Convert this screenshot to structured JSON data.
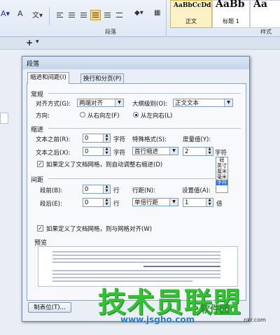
{
  "ribbon": {
    "group_paragraph": "段落",
    "group_styles": "样式",
    "styles": [
      {
        "preview": "AaBbCcDd",
        "name": "正文"
      },
      {
        "preview": "AaBb",
        "name": "标题 1"
      },
      {
        "preview": "Aa",
        "name": "标题 2"
      }
    ]
  },
  "doc": {
    "tab_add": "+",
    "tab_dropdown": "▾"
  },
  "dialog": {
    "title": "段落",
    "tabs": [
      "缩进和间距(I)",
      "换行和分页(P)"
    ],
    "general": {
      "section": "常规",
      "align_label": "对齐方式(G):",
      "align_value": "两端对齐",
      "outline_label": "大纲级别(O):",
      "outline_value": "正文文本",
      "direction_label": "方向:",
      "rtl_label": "从右向左(F)",
      "ltr_label": "从左向右(L)",
      "direction_selected": "ltr"
    },
    "indent": {
      "section": "缩进",
      "before_label": "文本之前(R):",
      "before_value": "0",
      "before_unit": "字符",
      "after_label": "文本之后(X):",
      "after_value": "0",
      "after_unit": "字符",
      "special_label": "特殊格式(S):",
      "special_value": "首行缩进",
      "measure_label": "度量值(Y):",
      "measure_value": "2",
      "measure_unit": "字符",
      "auto_adjust": "如果定义了文档网格，则自动调整右缩进(D)",
      "auto_adjust_checked": true,
      "unit_options": [
        "磅",
        "英寸",
        "厘米",
        "毫米",
        "字符"
      ],
      "unit_selected": "字符"
    },
    "spacing": {
      "section": "间距",
      "before_label": "段前(B):",
      "before_value": "0",
      "before_unit": "行",
      "after_label": "段后(E):",
      "after_value": "0",
      "after_unit": "行",
      "line_label": "行距(N):",
      "line_value": "单倍行距",
      "setting_label": "设置值(A):",
      "setting_value": "1",
      "setting_unit": "倍",
      "snap_grid": "如果定义了文档网格，则与网格对齐(W)",
      "snap_grid_checked": true
    },
    "preview_label": "预览",
    "tabs_button": "制表位(T)..."
  },
  "watermark": {
    "main": "技术员联盟",
    "site": "www.jsgho.com",
    "cn": "软件园",
    "en": "nkr.com"
  }
}
